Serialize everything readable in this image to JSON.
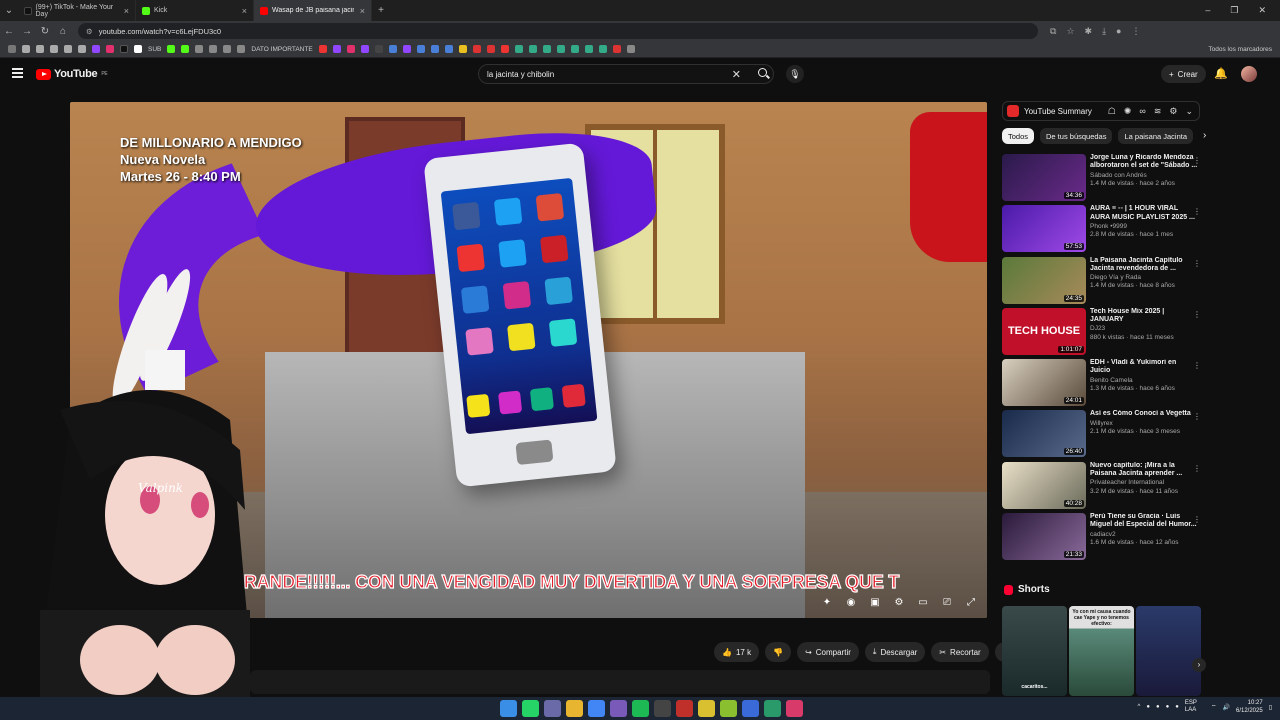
{
  "browser": {
    "tabs": [
      {
        "title": "(99+) TikTok - Make Your Day",
        "color": "#111111"
      },
      {
        "title": "Kick",
        "color": "#53fc18"
      },
      {
        "title": "Wasap de JB paisana jacinta - Y...",
        "color": "#ff0000",
        "active": true
      }
    ],
    "url": "youtube.com/watch?v=c6LejFDU3c0",
    "bookmarks": [
      "SUB",
      "DATO IMPORTANTE"
    ],
    "bookmarks_folder": "Todos los marcadores"
  },
  "youtube": {
    "logo": "YouTube",
    "region": "PE",
    "search_value": "la jacinta y chibolin",
    "create_label": "Crear",
    "video": {
      "overlay_title": "DE MILLONARIO A MENDIGO",
      "overlay_sub1": "Nueva Novela",
      "overlay_sub2": "Martes 26 - 8:40 PM",
      "caption": "GRANDE!!!!!... CON UNA VENGIDAD MUY DIVERTIDA Y UNA SORPRESA QUE T",
      "watermark": "Valpink"
    },
    "actions": {
      "likes": "17 k",
      "share": "Compartir",
      "download": "Descargar",
      "clip": "Recortar"
    },
    "summary_panel": {
      "title": "YouTube Summary"
    },
    "chips": [
      "Todos",
      "De tus búsquedas",
      "La paisana Jacinta"
    ],
    "recommendations": [
      {
        "title": "Jorge Luna y Ricardo Mendoza alborotaron el set de \"Sábado ...",
        "channel": "Sábado con Andrés",
        "meta": "1.4 M de vistas · hace 2 años",
        "duration": "34:36",
        "thumb": "#6a2a8a"
      },
      {
        "title": "AURA ≡ ◦◦ | 1 HOUR VIRAL AURA MUSIC PLAYLIST 2025 ...",
        "channel": "Phonk •9999",
        "meta": "2.8 M de vistas · hace 1 mes",
        "duration": "57:53",
        "thumb": "#7a3ad8"
      },
      {
        "title": "La Paisana Jacinta Capítulo Jacinta revendedora de ...",
        "channel": "Diego Vía y Rada",
        "meta": "1.4 M de vistas · hace 8 años",
        "duration": "24:35",
        "thumb": "#7a8a4a"
      },
      {
        "title": "Tech House Mix 2025 | JANUARY",
        "channel": "DJ23",
        "meta": "880 k vistas · hace 11 meses",
        "duration": "1:01:07",
        "thumb": "#c0102a",
        "thumb_text": "TECH HOUSE"
      },
      {
        "title": "EDH - Vladi & Yukimori en Juicio",
        "channel": "Benito Camela",
        "meta": "1.3 M de vistas · hace 6 años",
        "duration": "24:01",
        "thumb": "#8a7a6a"
      },
      {
        "title": "Así es Cómo Conocí a Vegetta",
        "channel": "Willyrex",
        "meta": "2.1 M de vistas · hace 3 meses",
        "duration": "26:40",
        "thumb": "#3a4a6a"
      },
      {
        "title": "Nuevo capítulo: ¡Mira a la Paisana Jacinta aprender ...",
        "channel": "Privateacher International",
        "meta": "3.2 M de vistas · hace 11 años",
        "duration": "40:28",
        "thumb": "#6a6a5a"
      },
      {
        "title": "Perú Tiene su Gracia · Luis Miguel del Especial del Humor...",
        "channel": "cadiacv2",
        "meta": "1.6 M de vistas · hace 12 años",
        "duration": "21:33",
        "thumb": "#4a3a5a"
      }
    ],
    "shorts_label": "Shorts",
    "shorts": [
      {
        "text": "",
        "color": "#3a4a4a",
        "caption": "cacaritos..."
      },
      {
        "text": "Yo con mi causa cuando cae Yape y no tenemos efectivo:",
        "color": "#5a8a7a"
      },
      {
        "text": "",
        "color": "#2a3a6a"
      }
    ]
  },
  "taskbar": {
    "language": "ESP LAA",
    "time": "10:27",
    "date": "6/12/2025"
  }
}
